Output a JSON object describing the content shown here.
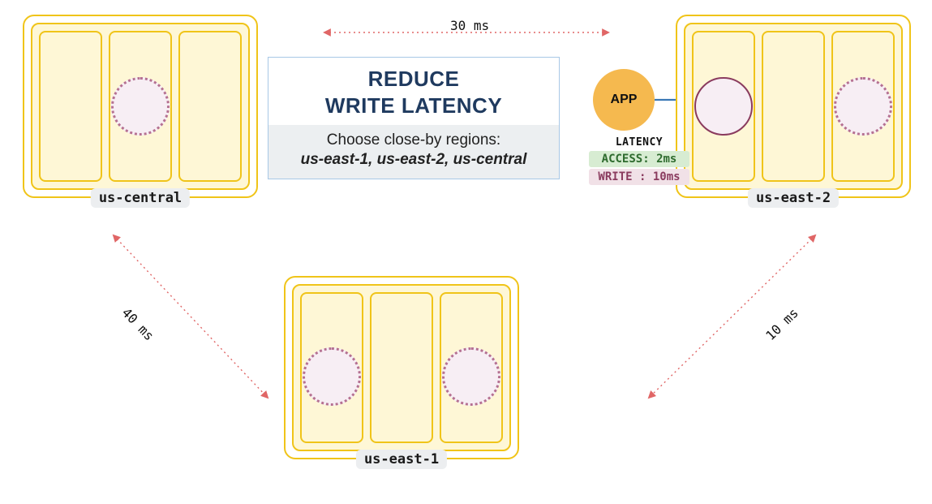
{
  "title_line1": "REDUCE",
  "title_line2": "WRITE LATENCY",
  "subtitle": "Choose close-by regions:",
  "subtitle_regions": "us-east-1, us-east-2, us-central",
  "app_label": "APP",
  "latency_heading": "LATENCY",
  "latency_access": "ACCESS: 2ms",
  "latency_write": "WRITE : 10ms",
  "regions": {
    "central": "us-central",
    "east2": "us-east-2",
    "east1": "us-east-1"
  },
  "links": {
    "top": "30 ms",
    "left": "40 ms",
    "right": "10 ms"
  }
}
